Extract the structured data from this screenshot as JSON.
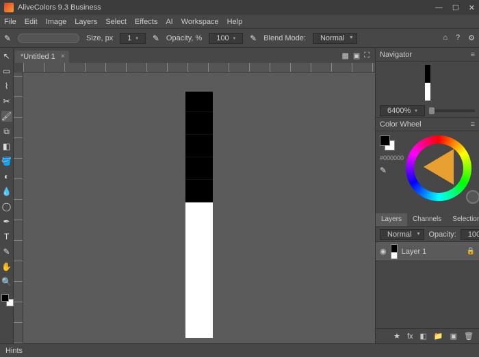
{
  "title": "AliveColors 9.3 Business",
  "menu": [
    "File",
    "Edit",
    "Image",
    "Layers",
    "Select",
    "Effects",
    "AI",
    "Workspace",
    "Help"
  ],
  "optbar": {
    "size_label": "Size, px",
    "size_val": "1",
    "opacity_label": "Opacity, %",
    "opacity_val": "100",
    "blend_label": "Blend Mode:",
    "blend_val": "Normal"
  },
  "doc_tab": "*Untitled 1",
  "navigator": {
    "title": "Navigator",
    "zoom": "6400%"
  },
  "colorwheel": {
    "title": "Color Wheel",
    "hex": "#000000"
  },
  "layers": {
    "tabs": [
      "Layers",
      "Channels",
      "Selections"
    ],
    "blend": "Normal",
    "opacity_label": "Opacity:",
    "opacity_val": "100",
    "layer_name": "Layer 1"
  },
  "hints": "Hints"
}
